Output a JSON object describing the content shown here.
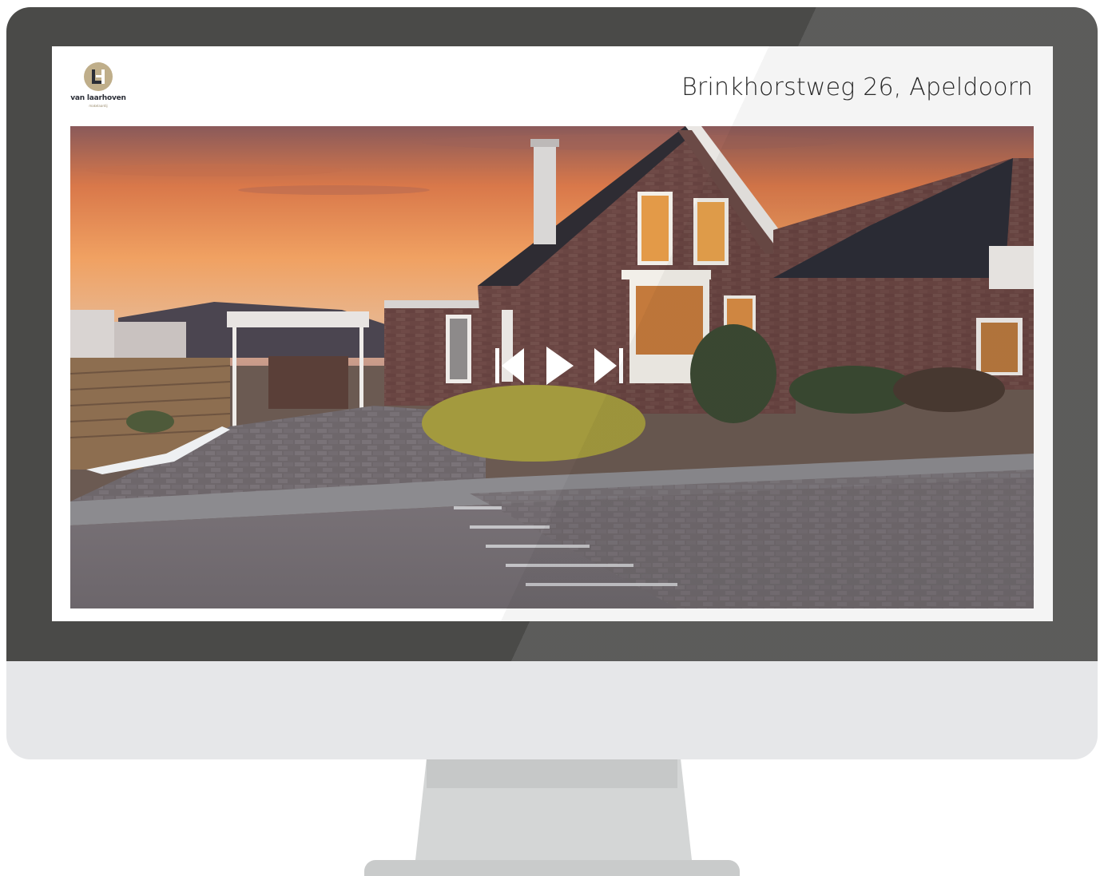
{
  "brand": {
    "logo_text": "van laarhoven",
    "logo_sub": "makelaardij",
    "logo_color": "#bfae8a"
  },
  "header": {
    "address": "Brinkhorstweg 26, Apeldoorn"
  },
  "slideshow": {
    "controls": [
      {
        "name": "previous",
        "icon": "skip-previous-icon"
      },
      {
        "name": "play",
        "icon": "play-icon"
      },
      {
        "name": "next",
        "icon": "skip-next-icon"
      }
    ]
  },
  "colors": {
    "bezel": "#4a4a48",
    "chin": "#e6e7e9",
    "stand": "#d4d6d6",
    "text": "#2b2b2b"
  }
}
